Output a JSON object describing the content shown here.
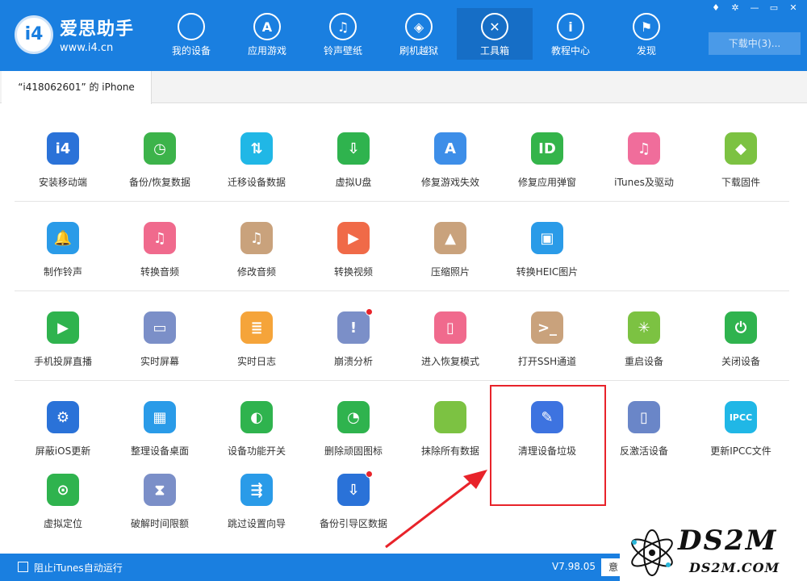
{
  "app": {
    "name": "爱思助手",
    "url": "www.i4.cn",
    "badge": "i4"
  },
  "nav": [
    {
      "label": "我的设备",
      "icon": "apple-icon",
      "glyph": "",
      "active": false
    },
    {
      "label": "应用游戏",
      "icon": "appstore-icon",
      "glyph": "A",
      "active": false
    },
    {
      "label": "铃声壁纸",
      "icon": "music-icon",
      "glyph": "♫",
      "active": false
    },
    {
      "label": "刷机越狱",
      "icon": "box-icon",
      "glyph": "◈",
      "active": false
    },
    {
      "label": "工具箱",
      "icon": "tools-icon",
      "glyph": "✕",
      "active": true
    },
    {
      "label": "教程中心",
      "icon": "info-icon",
      "glyph": "i",
      "active": false
    },
    {
      "label": "发现",
      "icon": "flag-icon",
      "glyph": "⚑",
      "active": false
    }
  ],
  "window_buttons": [
    "shirt-icon",
    "settings-icon",
    "minimize-icon",
    "maximize-icon",
    "close-icon"
  ],
  "window_glyphs": [
    "♦",
    "✲",
    "—",
    "▭",
    "✕"
  ],
  "download_label": "下载中(3)...",
  "tab_label": "“i418062601” 的 iPhone",
  "tools": [
    [
      {
        "label": "安装移动端",
        "icon": "i4-icon",
        "glyph": "i4",
        "color": "#2a72d8"
      },
      {
        "label": "备份/恢复数据",
        "icon": "clock-icon",
        "glyph": "◷",
        "color": "#3cb34a"
      },
      {
        "label": "迁移设备数据",
        "icon": "transfer-icon",
        "glyph": "⇅",
        "color": "#20b7e6"
      },
      {
        "label": "虚拟U盘",
        "icon": "usb-icon",
        "glyph": "⇩",
        "color": "#2fb34e"
      },
      {
        "label": "修复游戏失效",
        "icon": "appstore-repair-icon",
        "glyph": "A",
        "color": "#3d8ee8"
      },
      {
        "label": "修复应用弹窗",
        "icon": "appleid-icon",
        "glyph": "ID",
        "color": "#34b44a"
      },
      {
        "label": "iTunes及驱动",
        "icon": "itunes-icon",
        "glyph": "♫",
        "color": "#f06d9b"
      },
      {
        "label": "下载固件",
        "icon": "cube-icon",
        "glyph": "◆",
        "color": "#7cc242"
      }
    ],
    [
      {
        "label": "制作铃声",
        "icon": "bell-icon",
        "glyph": "🔔",
        "color": "#2a9be8"
      },
      {
        "label": "转换音频",
        "icon": "music-note-icon",
        "glyph": "♫",
        "color": "#f06a8d"
      },
      {
        "label": "修改音频",
        "icon": "music-edit-icon",
        "glyph": "♫",
        "color": "#c9a27c"
      },
      {
        "label": "转换视频",
        "icon": "play-icon",
        "glyph": "▶",
        "color": "#f06a48"
      },
      {
        "label": "压缩照片",
        "icon": "photo-icon",
        "glyph": "▲",
        "color": "#c9a27c"
      },
      {
        "label": "转换HEIC图片",
        "icon": "heic-icon",
        "glyph": "▣",
        "color": "#2a9be8"
      }
    ],
    [
      {
        "label": "手机投屏直播",
        "icon": "phone-play-icon",
        "glyph": "▶",
        "color": "#2fb34e",
        "dot": false
      },
      {
        "label": "实时屏幕",
        "icon": "monitor-icon",
        "glyph": "▭",
        "color": "#7b8fc8",
        "dot": false
      },
      {
        "label": "实时日志",
        "icon": "log-icon",
        "glyph": "≣",
        "color": "#f5a43a",
        "dot": false
      },
      {
        "label": "崩溃分析",
        "icon": "crash-icon",
        "glyph": "!",
        "color": "#7b8fc8",
        "dot": true
      },
      {
        "label": "进入恢复模式",
        "icon": "recovery-icon",
        "glyph": "▯",
        "color": "#f06a8d",
        "dot": false
      },
      {
        "label": "打开SSH通道",
        "icon": "ssh-icon",
        "glyph": ">_",
        "color": "#c9a27c",
        "dot": false
      },
      {
        "label": "重启设备",
        "icon": "restart-icon",
        "glyph": "✳",
        "color": "#7cc242",
        "dot": false
      },
      {
        "label": "关闭设备",
        "icon": "power-icon",
        "glyph": "⏻",
        "color": "#2fb34e",
        "dot": false
      }
    ],
    [
      {
        "label": "屏蔽iOS更新",
        "icon": "block-update-icon",
        "glyph": "⚙",
        "color": "#2a72d8",
        "dot": false
      },
      {
        "label": "整理设备桌面",
        "icon": "grid-icon",
        "glyph": "▦",
        "color": "#2a9be8",
        "dot": false
      },
      {
        "label": "设备功能开关",
        "icon": "toggle-icon",
        "glyph": "◐",
        "color": "#2fb34e",
        "dot": false
      },
      {
        "label": "删除顽固图标",
        "icon": "pie-icon",
        "glyph": "◔",
        "color": "#2fb34e",
        "dot": false
      },
      {
        "label": "抹除所有数据",
        "icon": "erase-icon",
        "glyph": "",
        "color": "#7cc242",
        "dot": false
      },
      {
        "label": "清理设备垃圾",
        "icon": "broom-icon",
        "glyph": "✎",
        "color": "#3d73e0",
        "dot": false
      },
      {
        "label": "反激活设备",
        "icon": "deactivate-icon",
        "glyph": "▯",
        "color": "#6a86c8",
        "dot": false
      },
      {
        "label": "更新IPCC文件",
        "icon": "ipcc-icon",
        "glyph": "IPCC",
        "color": "#20b7e6",
        "dot": false
      }
    ],
    [
      {
        "label": "虚拟定位",
        "icon": "location-icon",
        "glyph": "⊙",
        "color": "#2fb34e",
        "dot": false
      },
      {
        "label": "破解时间限额",
        "icon": "hourglass-icon",
        "glyph": "⧗",
        "color": "#7b8fc8",
        "dot": false
      },
      {
        "label": "跳过设置向导",
        "icon": "skip-icon",
        "glyph": "⇶",
        "color": "#2a9be8",
        "dot": false
      },
      {
        "label": "备份引导区数据",
        "icon": "disk-icon",
        "glyph": "⇩",
        "color": "#2a72d8",
        "dot": true
      }
    ]
  ],
  "status": {
    "block_itunes_label": "阻止iTunes自动运行",
    "version": "V7.98.05",
    "button_label": "意"
  },
  "watermark": {
    "big": "DS2M",
    "small": "DS2M.COM"
  }
}
